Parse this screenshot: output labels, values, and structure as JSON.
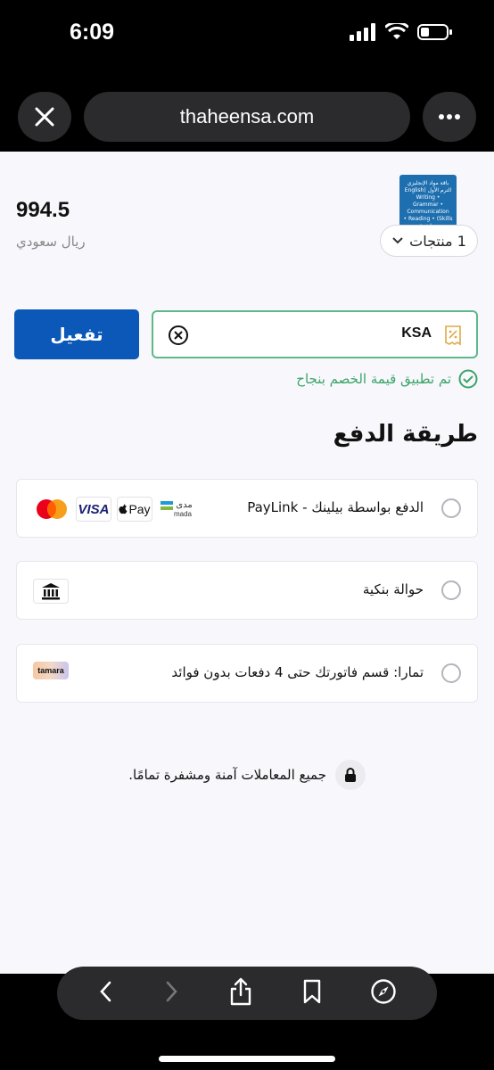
{
  "status_bar": {
    "time": "6:09"
  },
  "browser": {
    "url": "thaheensa.com"
  },
  "cart": {
    "price": "994.5",
    "currency": "ريال سعودي",
    "products_count": "1 منتجات",
    "thumb_text": "باقة مواد الإنجليزي الترم الأول (English Writing • Grammar • Communication Skills) • Reading • مباشرة"
  },
  "coupon": {
    "value": "KSA",
    "activate_label": "تفعيل",
    "success_message": "تم تطبيق قيمة الخصم بنجاح"
  },
  "payment": {
    "title": "طريقة الدفع",
    "methods": [
      {
        "label": "الدفع بواسطة بيلينك - PayLink"
      },
      {
        "label": "حوالة بنكية"
      },
      {
        "label": "تمارا: قسم فاتورتك حتى 4 دفعات بدون فوائد"
      }
    ],
    "badges": {
      "mada_ar": "مدى",
      "mada_en": "mada",
      "applepay": "Pay",
      "visa": "VISA",
      "tamara": "tamara"
    }
  },
  "security_note": "جميع المعاملات آمنة ومشفرة تمامًا.",
  "colors": {
    "primary": "#0b58b8",
    "success": "#3aa46a",
    "background": "#f8f8fc"
  }
}
